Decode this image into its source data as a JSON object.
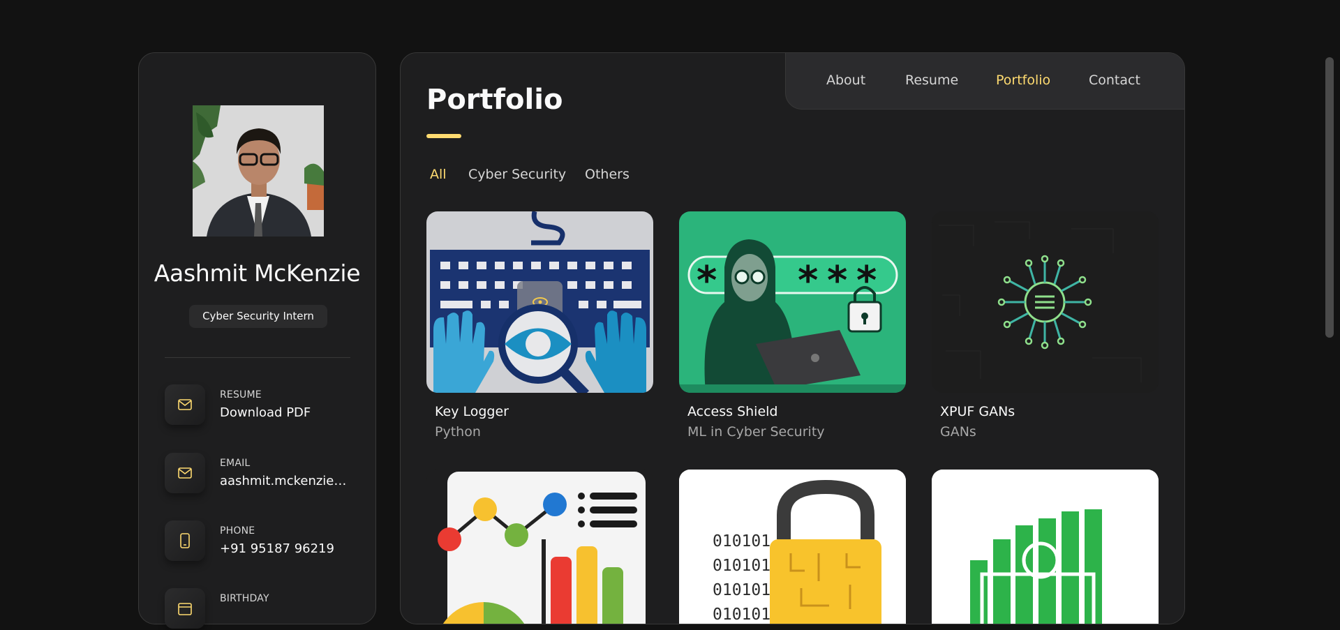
{
  "profile": {
    "name": "Aashmit McKenzie",
    "title": "Cyber Security Intern"
  },
  "contacts": [
    {
      "label": "Resume",
      "value": "Download PDF",
      "icon": "mail-icon"
    },
    {
      "label": "Email",
      "value": "aashmit.mckenzie@gmail.com",
      "icon": "mail-icon"
    },
    {
      "label": "Phone",
      "value": "+91 95187 96219",
      "icon": "phone-icon"
    },
    {
      "label": "Birthday",
      "value": "",
      "icon": "calendar-icon"
    }
  ],
  "nav": {
    "about": "About",
    "resume": "Resume",
    "portfolio": "Portfolio",
    "contact": "Contact",
    "active": "Portfolio"
  },
  "page": {
    "title": "Portfolio"
  },
  "filters": {
    "all": "All",
    "cyber_security": "Cyber Security",
    "others": "Others",
    "active": "All"
  },
  "projects": [
    {
      "title": "Key Logger",
      "category": "Python"
    },
    {
      "title": "Access Shield",
      "category": "ML in Cyber Security"
    },
    {
      "title": "XPUF GANs",
      "category": "GANs"
    },
    {
      "title": "",
      "category": ""
    },
    {
      "title": "",
      "category": ""
    },
    {
      "title": "",
      "category": ""
    }
  ],
  "colors": {
    "accent": "#ffdb70",
    "background": "#121212",
    "panel": "#1e1e1f",
    "border": "#383838"
  }
}
